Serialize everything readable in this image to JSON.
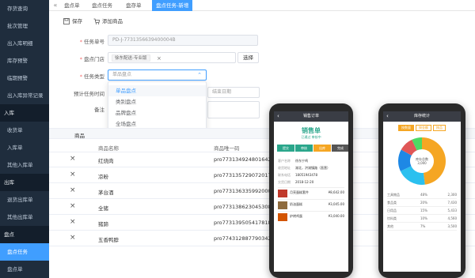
{
  "sidebar": {
    "items": [
      {
        "label": "存货查询",
        "type": "item"
      },
      {
        "label": "批次管理",
        "type": "item"
      },
      {
        "label": "出入库明细",
        "type": "item"
      },
      {
        "label": "库存预警",
        "type": "item"
      },
      {
        "label": "临期预警",
        "type": "item"
      },
      {
        "label": "出入库异常记录",
        "type": "item"
      },
      {
        "label": "入库",
        "type": "group"
      },
      {
        "label": "收货单",
        "type": "item"
      },
      {
        "label": "入库单",
        "type": "item"
      },
      {
        "label": "其他入库单",
        "type": "item"
      },
      {
        "label": "出库",
        "type": "group"
      },
      {
        "label": "退货出库单",
        "type": "item"
      },
      {
        "label": "其他出库单",
        "type": "item"
      },
      {
        "label": "盘点",
        "type": "group"
      },
      {
        "label": "盘点任务",
        "type": "active"
      },
      {
        "label": "盘点单",
        "type": "item"
      }
    ]
  },
  "tabs": [
    "盘点单",
    "盘点任务",
    "盘存单",
    "盘点任务-新增"
  ],
  "toolbar": {
    "save": "保存",
    "add_goods": "添加商品"
  },
  "form": {
    "task_no_label": "任务单号",
    "task_no_value": "PD-J-7731356639400004B",
    "store_label": "盘点门店",
    "store_tag": "徐东配送-专业版",
    "choose_button": "选择",
    "task_type_label": "任务类型",
    "task_type_value": "单品盘点",
    "expected_time_label": "预计任务时间",
    "end_date_placeholder": "结束日期",
    "remark_label": "备注"
  },
  "dropdown": {
    "options": [
      "单品盘点",
      "类别盘点",
      "品牌盘点",
      "全场盘点"
    ],
    "selected": 0
  },
  "table": {
    "section_title": "商品",
    "headers": [
      "商品名称",
      "商品唯一码"
    ],
    "rows": [
      {
        "name": "红烧肉",
        "code": "pro773134924801642496"
      },
      {
        "name": "凉粉",
        "code": "pro773135729072017408"
      },
      {
        "name": "茅台酒",
        "code": "pro773136335992000512"
      },
      {
        "name": "全猪",
        "code": "pro773138623045308416"
      },
      {
        "name": "猪蹄",
        "code": "pro773139505417818112"
      },
      {
        "name": "五香鸭脖",
        "code": "pro774312887790342144"
      }
    ]
  },
  "phone_left": {
    "bar_title": "销售订单",
    "header": "销售单",
    "status": "已通过 审核中",
    "steps": [
      "提交",
      "审核",
      "出库",
      "完成"
    ],
    "fields": [
      {
        "k": "客户名称",
        "v": "徐东宁鸡"
      },
      {
        "k": "收货地址",
        "v": "湖北，洪湖镇路（直营）"
      },
      {
        "k": "联系电话",
        "v": "18051943478"
      },
      {
        "k": "交货日期",
        "v": "2018-12-20"
      }
    ],
    "goods": [
      {
        "name": "月亮蛋糕套件",
        "price": "¥8,642.00"
      },
      {
        "name": "奶油蛋糕",
        "price": "¥3,045.00"
      },
      {
        "name": "炉烤鸡蛋",
        "price": "¥3,040.00"
      }
    ],
    "action_buttons": [
      "审核",
      "审核"
    ]
  },
  "phone_right": {
    "bar_title": "库存统计",
    "tabs": [
      "按数量",
      "按金额",
      "按品"
    ],
    "center_label": "库存总数\n3,000",
    "chart_data": {
      "type": "pie",
      "slices": [
        {
          "label": "工具物品",
          "value": 48
        },
        {
          "label": "食品类",
          "value": 20
        },
        {
          "label": "日用品",
          "value": 15
        },
        {
          "label": "饮料类",
          "value": 10
        },
        {
          "label": "其他",
          "value": 7
        }
      ]
    },
    "legend": [
      {
        "k": "工具物品",
        "p": "48%",
        "n": "2,300"
      },
      {
        "k": "食品类",
        "p": "20%",
        "n": "7,430"
      },
      {
        "k": "日用品",
        "p": "15%",
        "n": "5,433"
      },
      {
        "k": "饮料类",
        "p": "10%",
        "n": "4,560"
      },
      {
        "k": "其他",
        "p": "7%",
        "n": "3,500"
      }
    ],
    "colors": [
      "#f5a623",
      "#2bc0ef",
      "#1e88e5",
      "#e05757",
      "#4cd964"
    ]
  }
}
